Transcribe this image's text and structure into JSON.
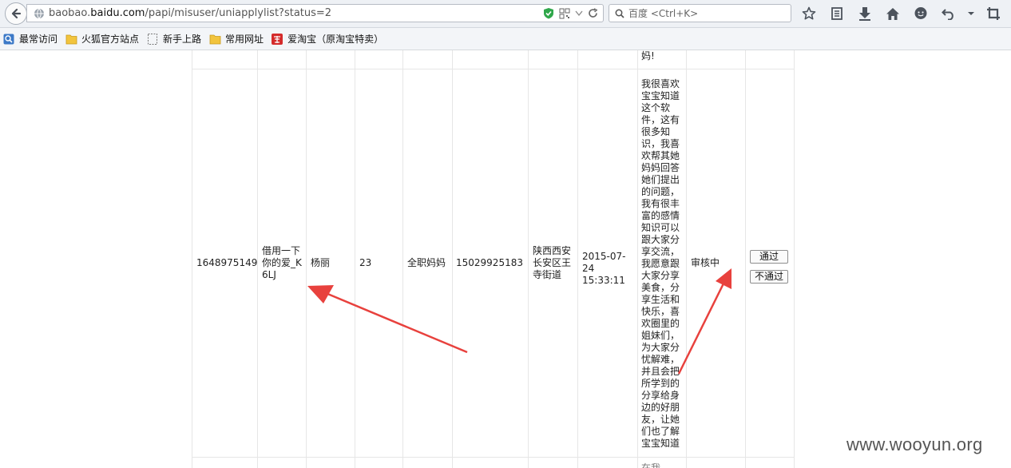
{
  "browser": {
    "url_prefix": "baobao.",
    "url_host": "baidu.com",
    "url_path": "/papi/misuser/uniapplylist?status=2",
    "search_placeholder": "百度 <Ctrl+K>"
  },
  "bookmarks": [
    {
      "label": "最常访问",
      "icon": "search-bookmark-icon"
    },
    {
      "label": "火狐官方站点",
      "icon": "folder-icon"
    },
    {
      "label": "新手上路",
      "icon": "dashed-page-icon"
    },
    {
      "label": "常用网址",
      "icon": "folder-icon"
    },
    {
      "label": "爱淘宝（原淘宝特卖）",
      "icon": "taobao-icon"
    }
  ],
  "previous_row_tail": "妈!",
  "row": {
    "id": "1648975149",
    "nickname": "借用一下你的爱_K6LJ",
    "name": "杨丽",
    "age": "23",
    "occupation": "全职妈妈",
    "phone": "15029925183",
    "address": "陕西西安长安区王寺街道",
    "time": "2015-07-24 15:33:11",
    "intro": "我很喜欢宝宝知道这个软件，这有很多知识，我喜欢帮其她妈妈回答她们提出的问题，我有很丰富的感情知识可以跟大家分享交流，我愿意跟大家分享美食，分享生活和快乐，喜欢圈里的姐妹们，为大家分忧解难，并且会把所学到的分享给身边的好朋友，让她们也了解宝宝知道",
    "status": "审核中",
    "approve_label": "通过",
    "reject_label": "不通过"
  },
  "next_row_partial": "在我...",
  "watermark": "www.wooyun.org",
  "colors": {
    "arrow": "#e8413d"
  }
}
